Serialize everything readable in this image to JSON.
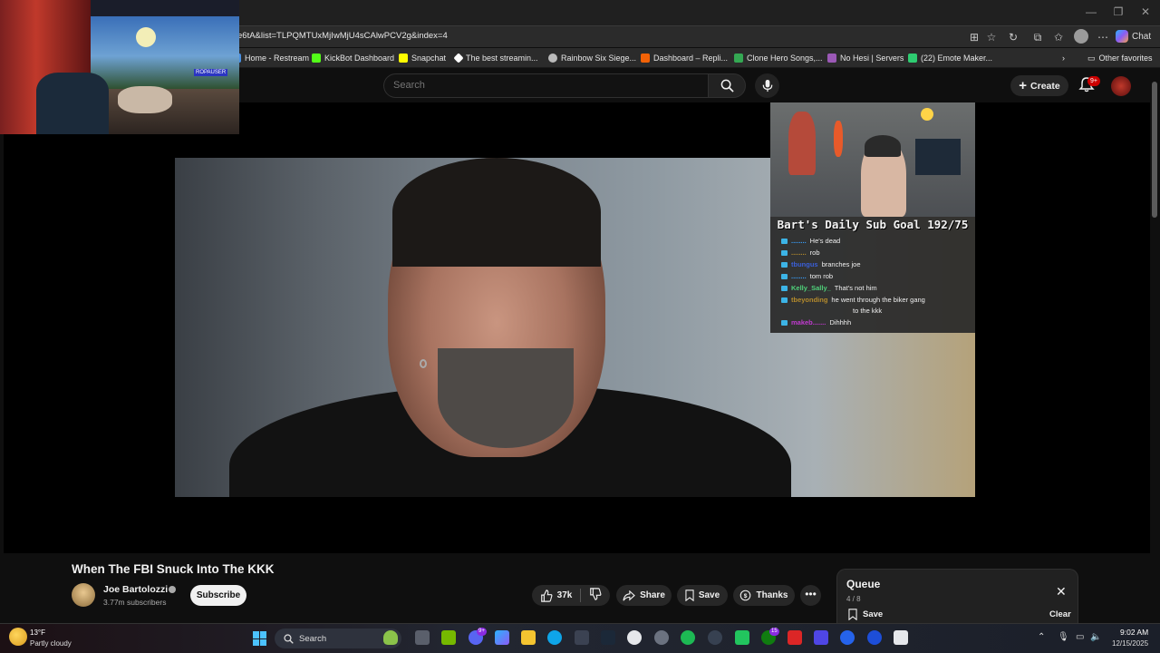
{
  "browser": {
    "url": "e6tA&list=TLPQMTUxMjIwMjU4sCAlwPCV2g&index=4",
    "copilot_label": "Chat",
    "bookmarks": [
      {
        "label": "Home - Restream",
        "color": "#4a90e2"
      },
      {
        "label": "KickBot Dashboard",
        "color": "#53fc18"
      },
      {
        "label": "Snapchat",
        "color": "#fffc00"
      },
      {
        "label": "The best streamin...",
        "color": "#ffffff"
      },
      {
        "label": "Rainbow Six Siege...",
        "color": "#bbbbbb"
      },
      {
        "label": "Dashboard – Repli...",
        "color": "#f26207"
      },
      {
        "label": "Clone Hero Songs,...",
        "color": "#34a853"
      },
      {
        "label": "No Hesi | Servers",
        "color": "#9b59b6"
      },
      {
        "label": "(22) Emote Maker...",
        "color": "#2ecc71"
      }
    ],
    "other_favorites": "Other favorites"
  },
  "youtube": {
    "search_placeholder": "Search",
    "create_label": "Create",
    "notif_badge": "9+"
  },
  "overlay": {
    "sub_goal": "Bart's Daily Sub Goal 192/75",
    "chat": [
      {
        "name": "........",
        "msg": "He's dead",
        "color": "#39a0ff"
      },
      {
        "name": "........",
        "msg": "rob",
        "color": "#b58b2c"
      },
      {
        "name": "tbungus",
        "msg": "branches joe",
        "color": "#3a5fd9"
      },
      {
        "name": "........",
        "msg": "tom rob",
        "color": "#39a0ff"
      },
      {
        "name": "Kelly_Sally_",
        "msg": "That's not him",
        "color": "#4fd17a"
      },
      {
        "name": "tbeyonding",
        "msg": "he went through the biker gang",
        "color": "#b58b2c"
      },
      {
        "name": "",
        "msg": "to the kkk",
        "color": "#ffffff"
      },
      {
        "name": "makeb.......",
        "msg": "Dihhhh",
        "color": "#c03ad0"
      }
    ],
    "stream_logo": "ROPAUSER"
  },
  "video": {
    "title": "When The FBI Snuck Into The KKK",
    "channel": "Joe Bartolozzi",
    "subscribers": "3.77m subscribers",
    "subscribe_label": "Subscribe",
    "likes": "37k",
    "share_label": "Share",
    "save_label": "Save",
    "thanks_label": "Thanks",
    "more_label": "•••"
  },
  "queue": {
    "title": "Queue",
    "count": "4 / 8",
    "save_label": "Save",
    "clear_label": "Clear"
  },
  "taskbar": {
    "temp": "13°F",
    "weather": "Partly cloudy",
    "search_label": "Search",
    "time": "9:02 AM",
    "date": "12/15/2025",
    "badges": {
      "discord": "9+",
      "xbox": "15"
    }
  }
}
